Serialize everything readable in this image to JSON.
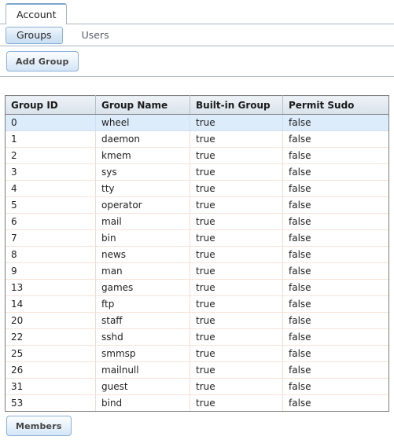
{
  "window": {
    "main_tab": "Account"
  },
  "subtabs": [
    {
      "label": "Groups",
      "selected": true
    },
    {
      "label": "Users",
      "selected": false
    }
  ],
  "toolbar": {
    "add_group_label": "Add Group"
  },
  "footer": {
    "members_label": "Members"
  },
  "colors": {
    "accent": "#7ea4cd",
    "selected_row": "#ddecfb",
    "button_border": "#8ab0d8",
    "grid_border": "#7d7d7d",
    "row_separator": "#f6e2d8"
  },
  "table": {
    "columns": [
      "Group ID",
      "Group Name",
      "Built-in Group",
      "Permit Sudo"
    ],
    "selected_row_index": 0,
    "rows": [
      [
        "0",
        "wheel",
        "true",
        "false"
      ],
      [
        "1",
        "daemon",
        "true",
        "false"
      ],
      [
        "2",
        "kmem",
        "true",
        "false"
      ],
      [
        "3",
        "sys",
        "true",
        "false"
      ],
      [
        "4",
        "tty",
        "true",
        "false"
      ],
      [
        "5",
        "operator",
        "true",
        "false"
      ],
      [
        "6",
        "mail",
        "true",
        "false"
      ],
      [
        "7",
        "bin",
        "true",
        "false"
      ],
      [
        "8",
        "news",
        "true",
        "false"
      ],
      [
        "9",
        "man",
        "true",
        "false"
      ],
      [
        "13",
        "games",
        "true",
        "false"
      ],
      [
        "14",
        "ftp",
        "true",
        "false"
      ],
      [
        "20",
        "staff",
        "true",
        "false"
      ],
      [
        "22",
        "sshd",
        "true",
        "false"
      ],
      [
        "25",
        "smmsp",
        "true",
        "false"
      ],
      [
        "26",
        "mailnull",
        "true",
        "false"
      ],
      [
        "31",
        "guest",
        "true",
        "false"
      ],
      [
        "53",
        "bind",
        "true",
        "false"
      ]
    ]
  }
}
